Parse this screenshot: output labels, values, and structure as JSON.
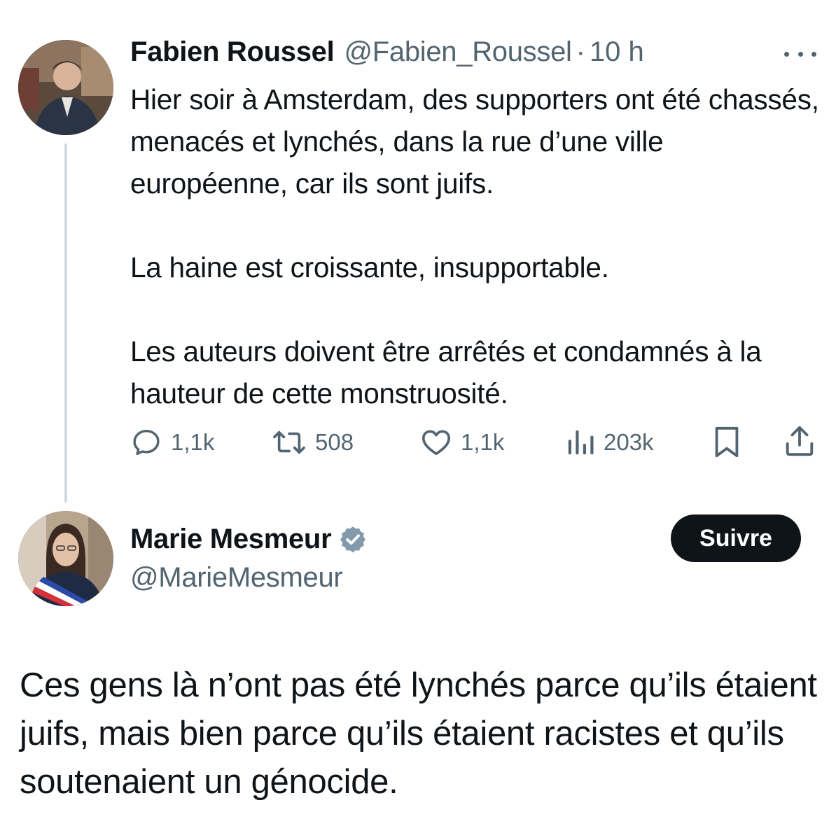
{
  "tweet1": {
    "author_name": "Fabien Roussel",
    "handle": "@Fabien_Roussel",
    "separator": "·",
    "time": "10 h",
    "paragraphs": [
      "Hier soir à Amsterdam, des supporters ont été chassés, menacés et lynchés, dans la rue d’une ville européenne, car ils sont juifs.",
      "La haine est croissante, insupportable.",
      "Les auteurs doivent être arrêtés et condamnés à la hauteur de cette monstruosité."
    ],
    "actions": {
      "replies": "1,1k",
      "reposts": "508",
      "likes": "1,1k",
      "views": "203k"
    },
    "icons": {
      "more": "more-horizontal-icon",
      "reply": "reply-bubble-icon",
      "repost": "repost-arrows-icon",
      "like": "heart-icon",
      "views": "views-bar-chart-icon",
      "bookmark": "bookmark-icon",
      "share": "share-upload-icon"
    }
  },
  "tweet2": {
    "author_name": "Marie Mesmeur",
    "handle": "@MarieMesmeur",
    "verified": true,
    "follow_label": "Suivre",
    "text": "Ces gens là n’ont pas été lynchés parce qu’ils étaient juifs, mais bien parce qu’ils étaient racistes et qu’ils soutenaient un génocide."
  },
  "colors": {
    "text_primary": "#0f1419",
    "text_secondary": "#536471",
    "thread_line": "#cfd9de",
    "follow_bg": "#0f1419",
    "verified_badge": "#829aab"
  }
}
